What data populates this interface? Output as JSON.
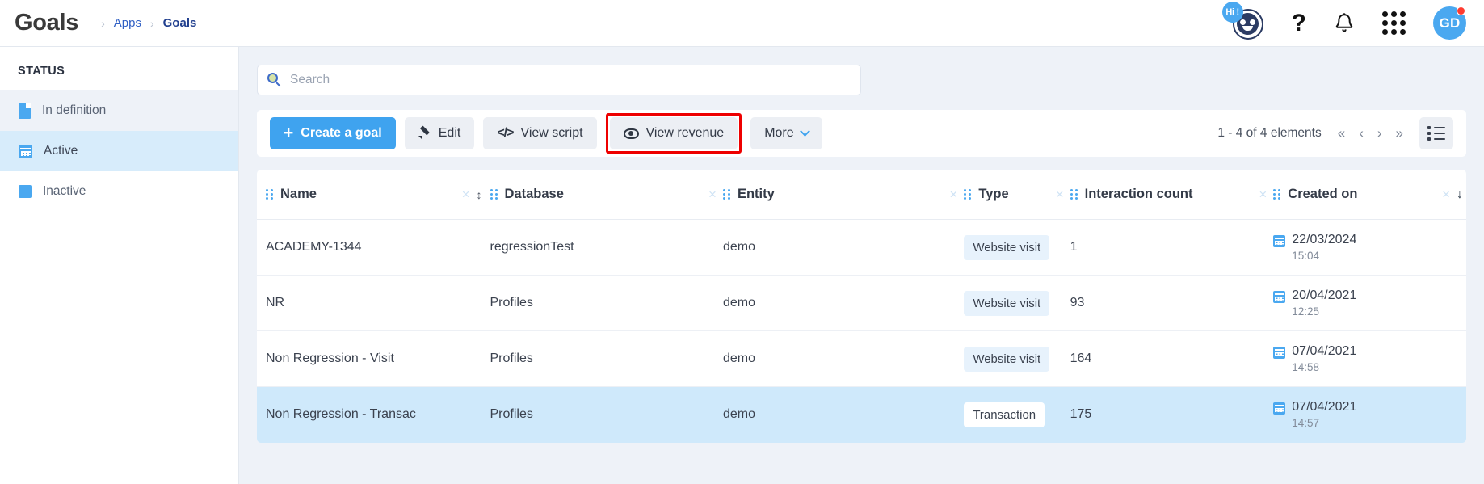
{
  "header": {
    "title": "Goals",
    "breadcrumb": [
      {
        "label": "Apps",
        "current": false
      },
      {
        "label": "Goals",
        "current": true
      }
    ],
    "bot_badge": "Hi !",
    "help_icon": "?",
    "avatar_initials": "GD"
  },
  "sidebar": {
    "section_title": "STATUS",
    "items": [
      {
        "label": "In definition",
        "icon": "document-icon"
      },
      {
        "label": "Active",
        "icon": "calendar-icon"
      },
      {
        "label": "Inactive",
        "icon": "square-icon"
      }
    ]
  },
  "search": {
    "placeholder": "Search",
    "value": ""
  },
  "toolbar": {
    "create_label": "Create a goal",
    "create_prefix": "+",
    "edit_label": "Edit",
    "view_script_label": "View script",
    "view_script_icon": "</>",
    "view_revenue_label": "View revenue",
    "more_label": "More",
    "highlight_color": "#ee0000"
  },
  "pagination": {
    "count_text": "1 - 4 of 4 elements",
    "first": "«",
    "prev": "‹",
    "next": "›",
    "last": "»"
  },
  "table": {
    "columns": [
      {
        "label": "Name",
        "clear": "×",
        "sort": "↕"
      },
      {
        "label": "Database",
        "clear": "×",
        "sort": ""
      },
      {
        "label": "Entity",
        "clear": "×",
        "sort": ""
      },
      {
        "label": "Type",
        "clear": "×",
        "sort": ""
      },
      {
        "label": "Interaction count",
        "clear": "×",
        "sort": ""
      },
      {
        "label": "Created on",
        "clear": "×",
        "sort": "↓"
      }
    ],
    "rows": [
      {
        "name": "ACADEMY-1344",
        "database": "regressionTest",
        "entity": "demo",
        "type": "Website visit",
        "type_style": "visit",
        "interaction_count": "1",
        "created_date": "22/03/2024",
        "created_time": "15:04",
        "selected": false
      },
      {
        "name": "NR",
        "database": "Profiles",
        "entity": "demo",
        "type": "Website visit",
        "type_style": "visit",
        "interaction_count": "93",
        "created_date": "20/04/2021",
        "created_time": "12:25",
        "selected": false
      },
      {
        "name": "Non Regression - Visit",
        "database": "Profiles",
        "entity": "demo",
        "type": "Website visit",
        "type_style": "visit",
        "interaction_count": "164",
        "created_date": "07/04/2021",
        "created_time": "14:58",
        "selected": false
      },
      {
        "name": "Non Regression - Transac",
        "database": "Profiles",
        "entity": "demo",
        "type": "Transaction",
        "type_style": "transaction",
        "interaction_count": "175",
        "created_date": "07/04/2021",
        "created_time": "14:57",
        "selected": true
      }
    ]
  },
  "colors": {
    "accent": "#4aa8f0",
    "primary_button": "#3fa3ef",
    "selected_row": "#cfe9fb",
    "page_background": "#eef2f8"
  }
}
